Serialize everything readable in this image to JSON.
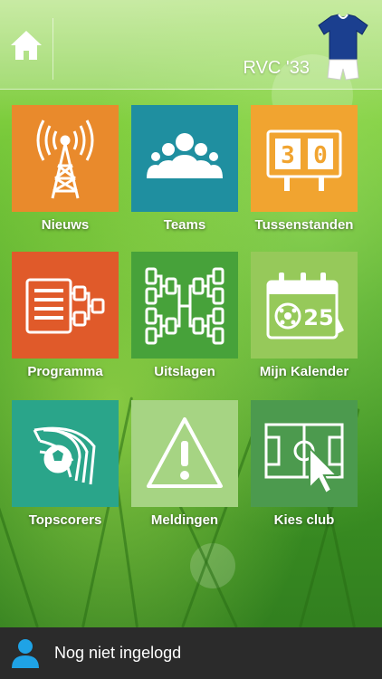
{
  "header": {
    "home_icon": "home-icon",
    "club_name": "RVC '33",
    "jersey_icon": "jersey-icon",
    "jersey_colors": {
      "shirt": "#1b3f8f",
      "shorts": "#ffffff"
    }
  },
  "tiles": [
    {
      "label": "Nieuws",
      "icon": "radio-tower-icon",
      "color": "#e98a2c"
    },
    {
      "label": "Teams",
      "icon": "group-icon",
      "color": "#1f8fa0"
    },
    {
      "label": "Tussenstanden",
      "icon": "scoreboard-icon",
      "color": "#f1a430",
      "score": "30"
    },
    {
      "label": "Programma",
      "icon": "schedule-icon",
      "color": "#e05a2a"
    },
    {
      "label": "Uitslagen",
      "icon": "bracket-icon",
      "color": "#47a23a"
    },
    {
      "label": "Mijn Kalender",
      "icon": "calendar-icon",
      "color": "#96c95a",
      "day": "25"
    },
    {
      "label": "Topscorers",
      "icon": "goal-net-icon",
      "color": "#2aa58a"
    },
    {
      "label": "Meldingen",
      "icon": "warning-icon",
      "color": "#a6d483"
    },
    {
      "label": "Kies club",
      "icon": "pitch-cursor-icon",
      "color": "#4c9a4e"
    }
  ],
  "footer": {
    "user_icon": "user-icon",
    "status": "Nog niet ingelogd",
    "accent": "#1fa3e6"
  }
}
